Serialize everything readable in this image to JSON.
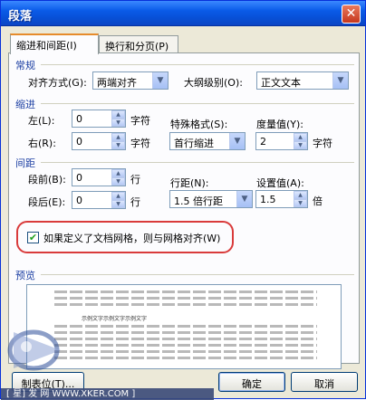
{
  "window": {
    "title": "段落",
    "close_glyph": "✕"
  },
  "tabs": [
    {
      "label": "缩进和间距(I)",
      "active": true
    },
    {
      "label": "换行和分页(P)",
      "active": false
    }
  ],
  "general": {
    "title": "常规",
    "alignment_label": "对齐方式(G):",
    "alignment_value": "两端对齐",
    "outline_label": "大纲级别(O):",
    "outline_value": "正文文本"
  },
  "indent": {
    "title": "缩进",
    "left_label": "左(L):",
    "left_value": "0",
    "left_unit": "字符",
    "right_label": "右(R):",
    "right_value": "0",
    "right_unit": "字符",
    "special_label": "特殊格式(S):",
    "special_value": "首行缩进",
    "by_label": "度量值(Y):",
    "by_value": "2",
    "by_unit": "字符"
  },
  "spacing": {
    "title": "间距",
    "before_label": "段前(B):",
    "before_value": "0",
    "before_unit": "行",
    "after_label": "段后(E):",
    "after_value": "0",
    "after_unit": "行",
    "line_label": "行距(N):",
    "line_value": "1.5 倍行距",
    "at_label": "设置值(A):",
    "at_value": "1.5",
    "at_unit": "倍"
  },
  "grid_option": {
    "label": "如果定义了文档网格，则与网格对齐(W)",
    "checked": true,
    "check_glyph": "✔"
  },
  "preview": {
    "title": "预览",
    "sample_text": "示例文字示例文字示例文字"
  },
  "buttons": {
    "tabs_label": "制表位(T)...",
    "ok_label": "确定",
    "cancel_label": "取消"
  },
  "watermark": {
    "site_text": "[ 星] 发  网 WWW.XKER.COM ]"
  },
  "colors": {
    "titlebar": "#0a5be8",
    "section_title": "#1c3fa3",
    "highlight_ring": "#d93b3b",
    "check_mark": "#21a121"
  }
}
